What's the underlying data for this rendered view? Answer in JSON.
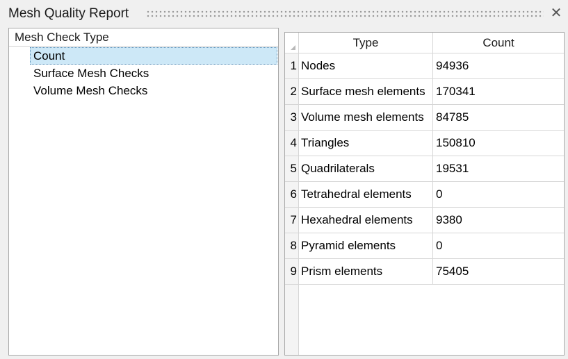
{
  "window": {
    "title": "Mesh Quality Report",
    "close_glyph": "✕"
  },
  "tree": {
    "header": "Mesh Check Type",
    "items": [
      {
        "label": "Count",
        "selected": true
      },
      {
        "label": "Surface Mesh Checks",
        "selected": false
      },
      {
        "label": "Volume Mesh Checks",
        "selected": false
      }
    ]
  },
  "table": {
    "columns": [
      "Type",
      "Count"
    ],
    "rows": [
      {
        "num": "1",
        "type": "Nodes",
        "count": "94936"
      },
      {
        "num": "2",
        "type": "Surface mesh elements",
        "count": "170341"
      },
      {
        "num": "3",
        "type": "Volume mesh elements",
        "count": "84785"
      },
      {
        "num": "4",
        "type": "Triangles",
        "count": "150810"
      },
      {
        "num": "5",
        "type": "Quadrilaterals",
        "count": "19531"
      },
      {
        "num": "6",
        "type": "Tetrahedral elements",
        "count": "0"
      },
      {
        "num": "7",
        "type": "Hexahedral elements",
        "count": "9380"
      },
      {
        "num": "8",
        "type": "Pyramid elements",
        "count": "0"
      },
      {
        "num": "9",
        "type": "Prism elements",
        "count": "75405"
      }
    ]
  },
  "colors": {
    "selection": "#cde8f7",
    "background": "#f0f0f0"
  }
}
